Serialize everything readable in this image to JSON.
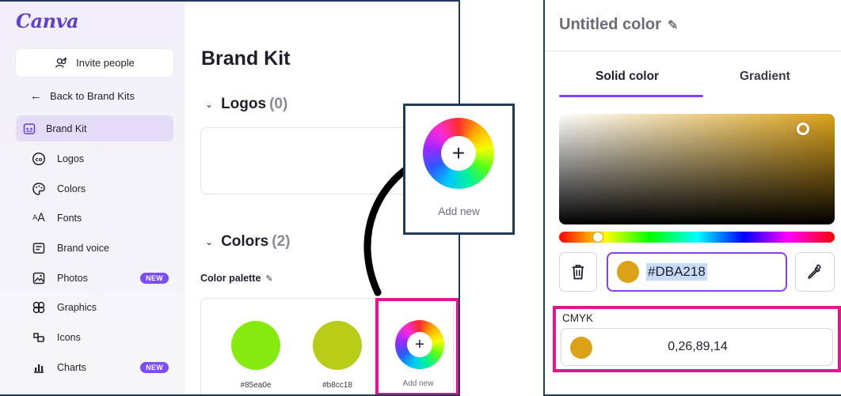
{
  "sidebar": {
    "logo": "Canva",
    "invite_label": "Invite people",
    "back_label": "Back to Brand Kits",
    "items": [
      {
        "label": "Brand Kit",
        "icon": "brand-kit-icon",
        "badge": ""
      },
      {
        "label": "Logos",
        "icon": "logos-icon",
        "badge": ""
      },
      {
        "label": "Colors",
        "icon": "palette-icon",
        "badge": ""
      },
      {
        "label": "Fonts",
        "icon": "fonts-icon",
        "badge": ""
      },
      {
        "label": "Brand voice",
        "icon": "brand-voice-icon",
        "badge": ""
      },
      {
        "label": "Photos",
        "icon": "photos-icon",
        "badge": "NEW"
      },
      {
        "label": "Graphics",
        "icon": "graphics-icon",
        "badge": ""
      },
      {
        "label": "Icons",
        "icon": "icons-icon",
        "badge": ""
      },
      {
        "label": "Charts",
        "icon": "charts-icon",
        "badge": "NEW"
      }
    ]
  },
  "main": {
    "title": "Brand Kit",
    "logos_heading": "Logos",
    "logos_count": "(0)",
    "colors_heading": "Colors",
    "colors_count": "(2)",
    "palette_label": "Color palette",
    "swatches": [
      {
        "hex": "#85ea0e",
        "label": "#85ea0e"
      },
      {
        "hex": "#b8cc18",
        "label": "#b8cc18"
      }
    ],
    "add_new_label": "Add new",
    "callout_add_label": "Add new"
  },
  "picker": {
    "title": "Untitled color",
    "tab_solid": "Solid color",
    "tab_gradient": "Gradient",
    "hex_value": "#DBA218",
    "current_color": "#dba218",
    "cmyk_label": "CMYK",
    "cmyk_value": "0,26,89,14"
  },
  "colors": {
    "accent": "#8b3dff",
    "highlight": "#e0168f",
    "frame": "#1f3b57"
  }
}
